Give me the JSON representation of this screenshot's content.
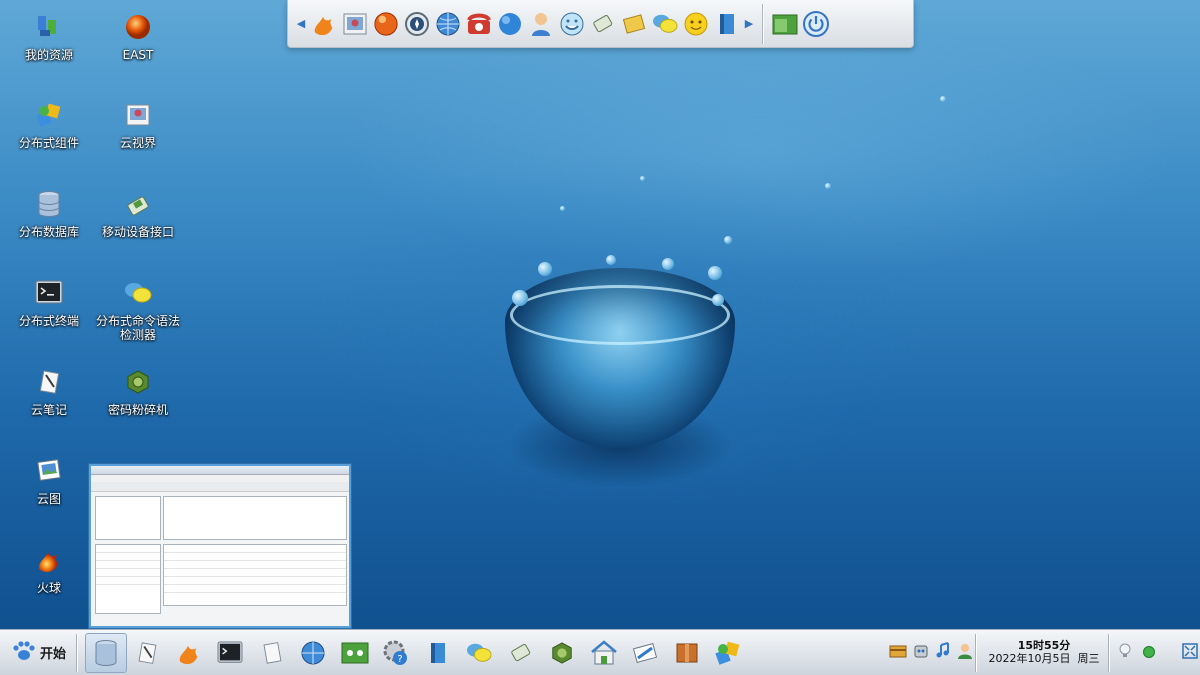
{
  "desktop": {
    "icons": [
      {
        "label": "我的资源",
        "icon": "my-resources-icon"
      },
      {
        "label": "EAST",
        "icon": "east-orb-icon"
      },
      {
        "label": "分布式组件",
        "icon": "distributed-components-icon"
      },
      {
        "label": "云视界",
        "icon": "cloud-vision-icon"
      },
      {
        "label": "分布数据库",
        "icon": "database-icon"
      },
      {
        "label": "移动设备接口",
        "icon": "mobile-interface-icon"
      },
      {
        "label": "分布式终端",
        "icon": "terminal-icon"
      },
      {
        "label": "分布式命令语法检测器",
        "icon": "chat-bubble-icon"
      },
      {
        "label": "云笔记",
        "icon": "notebook-icon"
      },
      {
        "label": "密码粉碎机",
        "icon": "shredder-icon"
      },
      {
        "label": "云图",
        "icon": "cloud-image-icon"
      },
      {
        "label": "火球",
        "icon": "fireball-icon"
      }
    ]
  },
  "top_dock": {
    "items": [
      "fireball-icon",
      "photo-icon",
      "orb-icon",
      "compass-icon",
      "globe-icon",
      "phone-icon",
      "blue-ball-icon",
      "user-icon",
      "face-icon",
      "notebook-icon",
      "note-icon",
      "chat-bubble-icon",
      "smiley-icon",
      "book-icon"
    ],
    "right_items": [
      "window-icon",
      "power-icon"
    ]
  },
  "taskbar": {
    "start_label": "开始",
    "apps": [
      "database-icon",
      "notebook-icon",
      "fireball-icon",
      "terminal-icon",
      "notes-icon",
      "globe-icon",
      "board-icon",
      "settings-help-icon",
      "book-icon",
      "chat-bubble-icon",
      "mobile-interface-icon",
      "shredder-icon",
      "home-icon",
      "pen-icon",
      "box-icon",
      "distributed-components-icon"
    ],
    "tray": [
      "card-icon",
      "robot-icon",
      "music-icon",
      "user-icon"
    ],
    "clock": {
      "time": "15时55分",
      "date": "2022年10月5日",
      "weekday": "周三"
    },
    "tray_right": [
      "bulb-icon",
      "status-dot-icon",
      "fullscreen-icon"
    ]
  },
  "colors": {
    "desktop_blue": "#2f7fc0",
    "taskbar": "#dfe4ea",
    "accent": "#3574c4"
  }
}
